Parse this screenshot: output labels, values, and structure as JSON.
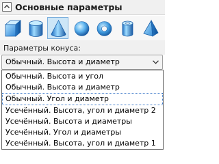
{
  "header": {
    "title": "Основные параметры"
  },
  "shapes": [
    {
      "icon": "cube-icon",
      "active": false
    },
    {
      "icon": "cylinder-icon",
      "active": false
    },
    {
      "icon": "cone-icon",
      "active": true
    },
    {
      "icon": "sphere-icon",
      "active": false
    },
    {
      "icon": "torus-icon",
      "active": false
    },
    {
      "icon": "cylinder-tube-icon",
      "active": false
    },
    {
      "icon": "pyramid-icon",
      "active": false
    }
  ],
  "cone": {
    "label": "Параметры конуса:",
    "selected": "Обычный. Высота и диаметр",
    "options": [
      "Обычный. Высота и угол",
      "Обычный. Высота и диаметр",
      "Обычный. Угол и диаметр",
      "Усечённый. Высота, угол и диаметр 2",
      "Усечённый. Высота и диаметры",
      "Усечённый. Угол и диаметры",
      "Усечённый. Высота, угол и диаметр 1"
    ],
    "focused_option": "Обычный. Угол и диаметр"
  },
  "colors": {
    "accent": "#cde6f7",
    "shape_light": "#8fd0ff",
    "shape_dark": "#1f6fbf"
  }
}
